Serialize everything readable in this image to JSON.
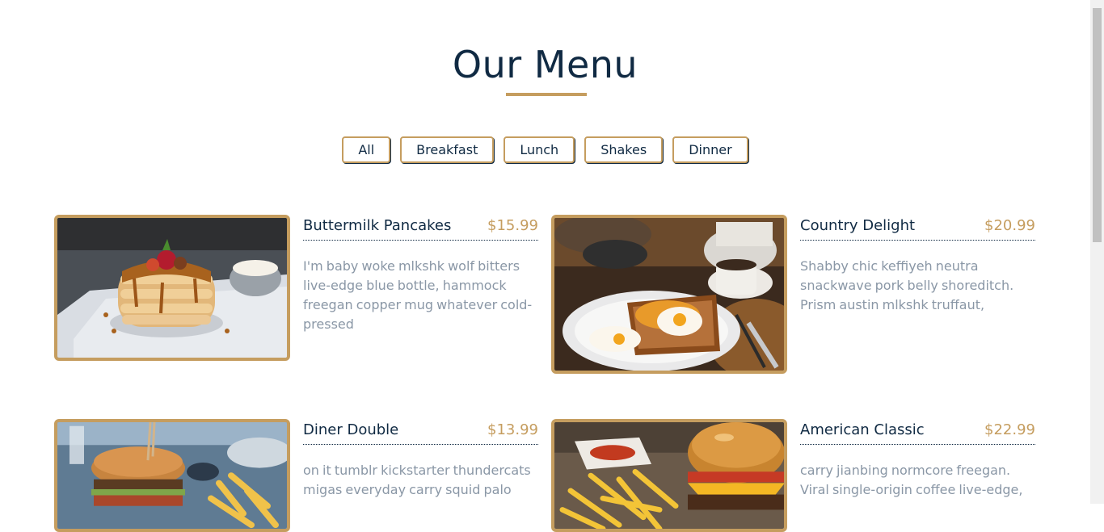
{
  "section": {
    "title": "Our Menu"
  },
  "filters": [
    "All",
    "Breakfast",
    "Lunch",
    "Shakes",
    "Dinner"
  ],
  "items": [
    {
      "name": "Buttermilk Pancakes",
      "price": "$15.99",
      "description": "I'm baby woke mlkshk wolf bitters live-edge blue bottle, hammock freegan copper mug whatever cold-pressed",
      "image": "pancakes-photo"
    },
    {
      "name": "Country Delight",
      "price": "$20.99",
      "description": "Shabby chic keffiyeh neutra snackwave pork belly shoreditch. Prism austin mlkshk truffaut,",
      "image": "eggs-toast-photo"
    },
    {
      "name": "Diner Double",
      "price": "$13.99",
      "description": "on it tumblr kickstarter thundercats migas everyday carry squid palo",
      "image": "burger-fries-photo"
    },
    {
      "name": "American Classic",
      "price": "$22.99",
      "description": "carry jianbing normcore freegan. Viral single-origin coffee live-edge,",
      "image": "cheeseburger-photo"
    }
  ],
  "colors": {
    "accent": "#c59d5f",
    "heading": "#102a43",
    "text": "#8a97a6"
  }
}
